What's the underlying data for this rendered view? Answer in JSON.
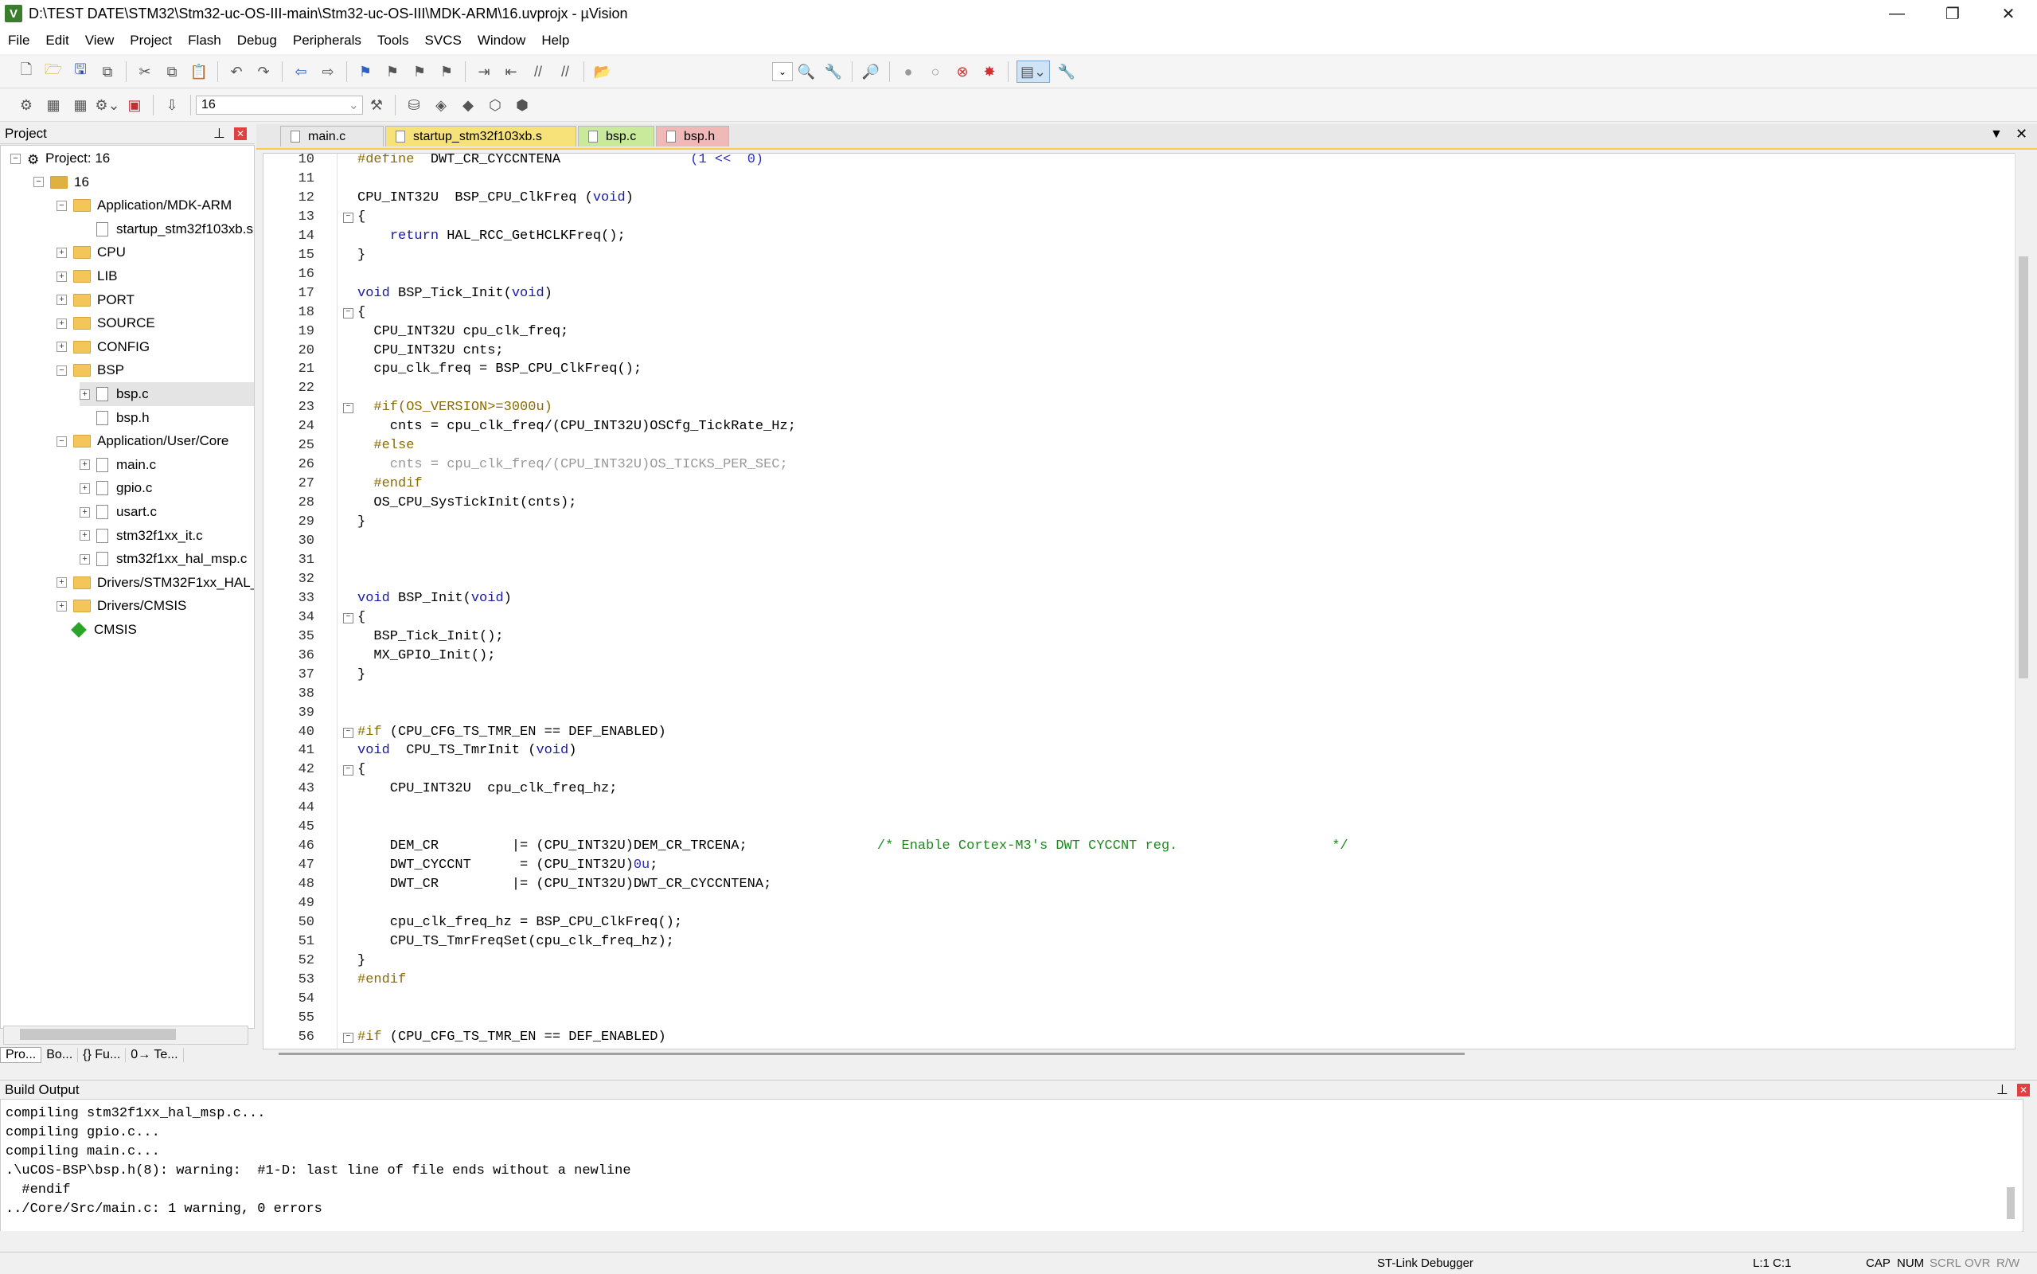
{
  "window": {
    "title": "D:\\TEST DATE\\STM32\\Stm32-uc-OS-III-main\\Stm32-uc-OS-III\\MDK-ARM\\16.uvprojx - µVision"
  },
  "menu": [
    "File",
    "Edit",
    "View",
    "Project",
    "Flash",
    "Debug",
    "Peripherals",
    "Tools",
    "SVCS",
    "Window",
    "Help"
  ],
  "toolbar2": {
    "target": "16"
  },
  "project": {
    "header": "Project",
    "tree": [
      {
        "label": "Project: 16",
        "depth": 0,
        "type": "root",
        "exp": "−"
      },
      {
        "label": "16",
        "depth": 1,
        "type": "target",
        "exp": "−"
      },
      {
        "label": "Application/MDK-ARM",
        "depth": 2,
        "type": "folder",
        "exp": "−"
      },
      {
        "label": "startup_stm32f103xb.s",
        "depth": 3,
        "type": "file",
        "exp": ""
      },
      {
        "label": "CPU",
        "depth": 2,
        "type": "folder",
        "exp": "+"
      },
      {
        "label": "LIB",
        "depth": 2,
        "type": "folder",
        "exp": "+"
      },
      {
        "label": "PORT",
        "depth": 2,
        "type": "folder",
        "exp": "+"
      },
      {
        "label": "SOURCE",
        "depth": 2,
        "type": "folder",
        "exp": "+"
      },
      {
        "label": "CONFIG",
        "depth": 2,
        "type": "folder",
        "exp": "+"
      },
      {
        "label": "BSP",
        "depth": 2,
        "type": "folder",
        "exp": "−"
      },
      {
        "label": "bsp.c",
        "depth": 3,
        "type": "file",
        "exp": "+"
      },
      {
        "label": "bsp.h",
        "depth": 3,
        "type": "file",
        "exp": ""
      },
      {
        "label": "Application/User/Core",
        "depth": 2,
        "type": "folder",
        "exp": "−"
      },
      {
        "label": "main.c",
        "depth": 3,
        "type": "file",
        "exp": "+"
      },
      {
        "label": "gpio.c",
        "depth": 3,
        "type": "file",
        "exp": "+"
      },
      {
        "label": "usart.c",
        "depth": 3,
        "type": "file",
        "exp": "+"
      },
      {
        "label": "stm32f1xx_it.c",
        "depth": 3,
        "type": "file",
        "exp": "+"
      },
      {
        "label": "stm32f1xx_hal_msp.c",
        "depth": 3,
        "type": "file",
        "exp": "+"
      },
      {
        "label": "Drivers/STM32F1xx_HAL_Driver",
        "depth": 2,
        "type": "folder",
        "exp": "+"
      },
      {
        "label": "Drivers/CMSIS",
        "depth": 2,
        "type": "folder",
        "exp": "+"
      },
      {
        "label": "CMSIS",
        "depth": 2,
        "type": "gem",
        "exp": ""
      }
    ],
    "tabs": [
      "Pro...",
      "Bo...",
      "{} Fu...",
      "0→ Te..."
    ]
  },
  "editor": {
    "tabs": [
      {
        "label": "main.c",
        "color": "#e8e8e8"
      },
      {
        "label": "startup_stm32f103xb.s",
        "color": "#f7e27a"
      },
      {
        "label": "bsp.c",
        "color": "#c9ea9a"
      },
      {
        "label": "bsp.h",
        "color": "#f1b8b8"
      }
    ],
    "lines": [
      {
        "n": "10",
        "fold": "",
        "html": "<span style='color:#8b6c00'>#define</span>  DWT_CR_CYCCNTENA                <span style='color:#3030c0'>(1 &lt;&lt;  0)</span>"
      },
      {
        "n": "11",
        "fold": "",
        "html": ""
      },
      {
        "n": "12",
        "fold": "",
        "html": "CPU_INT32U  BSP_CPU_ClkFreq (<span style='color:#1a1aa6'>void</span>)"
      },
      {
        "n": "13",
        "fold": "−",
        "html": "{"
      },
      {
        "n": "14",
        "fold": "",
        "html": "    <span style='color:#1a1aa6'>return</span> HAL_RCC_GetHCLKFreq();"
      },
      {
        "n": "15",
        "fold": "",
        "html": "}"
      },
      {
        "n": "16",
        "fold": "",
        "html": ""
      },
      {
        "n": "17",
        "fold": "",
        "html": "<span style='color:#1a1aa6'>void</span> BSP_Tick_Init(<span style='color:#1a1aa6'>void</span>)"
      },
      {
        "n": "18",
        "fold": "−",
        "html": "{"
      },
      {
        "n": "19",
        "fold": "",
        "html": "  CPU_INT32U cpu_clk_freq;"
      },
      {
        "n": "20",
        "fold": "",
        "html": "  CPU_INT32U cnts;"
      },
      {
        "n": "21",
        "fold": "",
        "html": "  cpu_clk_freq = BSP_CPU_ClkFreq();"
      },
      {
        "n": "22",
        "fold": "",
        "html": ""
      },
      {
        "n": "23",
        "fold": "−",
        "html": "  <span style='color:#8b6c00'>#if(OS_VERSION&gt;=3000u)</span>"
      },
      {
        "n": "24",
        "fold": "",
        "html": "    cnts = cpu_clk_freq/(CPU_INT32U)OSCfg_TickRate_Hz;"
      },
      {
        "n": "25",
        "fold": "",
        "html": "  <span style='color:#8b6c00'>#else</span>"
      },
      {
        "n": "26",
        "fold": "",
        "html": "<span style='color:#999'>    cnts = cpu_clk_freq/(CPU_INT32U)OS_TICKS_PER_SEC;</span>"
      },
      {
        "n": "27",
        "fold": "",
        "html": "  <span style='color:#8b6c00'>#endif</span>"
      },
      {
        "n": "28",
        "fold": "",
        "html": "  OS_CPU_SysTickInit(cnts);"
      },
      {
        "n": "29",
        "fold": "",
        "html": "}"
      },
      {
        "n": "30",
        "fold": "",
        "html": ""
      },
      {
        "n": "31",
        "fold": "",
        "html": ""
      },
      {
        "n": "32",
        "fold": "",
        "html": ""
      },
      {
        "n": "33",
        "fold": "",
        "html": "<span style='color:#1a1aa6'>void</span> BSP_Init(<span style='color:#1a1aa6'>void</span>)"
      },
      {
        "n": "34",
        "fold": "−",
        "html": "{"
      },
      {
        "n": "35",
        "fold": "",
        "html": "  BSP_Tick_Init();"
      },
      {
        "n": "36",
        "fold": "",
        "html": "  MX_GPIO_Init();"
      },
      {
        "n": "37",
        "fold": "",
        "html": "}"
      },
      {
        "n": "38",
        "fold": "",
        "html": ""
      },
      {
        "n": "39",
        "fold": "",
        "html": ""
      },
      {
        "n": "40",
        "fold": "−",
        "html": "<span style='color:#8b6c00'>#if</span> (CPU_CFG_TS_TMR_EN == DEF_ENABLED)"
      },
      {
        "n": "41",
        "fold": "",
        "html": "<span style='color:#1a1aa6'>void</span>  CPU_TS_TmrInit (<span style='color:#1a1aa6'>void</span>)"
      },
      {
        "n": "42",
        "fold": "−",
        "html": "{"
      },
      {
        "n": "43",
        "fold": "",
        "html": "    CPU_INT32U  cpu_clk_freq_hz;"
      },
      {
        "n": "44",
        "fold": "",
        "html": ""
      },
      {
        "n": "45",
        "fold": "",
        "html": ""
      },
      {
        "n": "46",
        "fold": "",
        "html": "    DEM_CR         |= (CPU_INT32U)DEM_CR_TRCENA;                <span style='color:#1d8a1d'>/* Enable Cortex-M3's DWT CYCCNT reg.                   */</span>"
      },
      {
        "n": "47",
        "fold": "",
        "html": "    DWT_CYCCNT      = (CPU_INT32U)<span style='color:#3030c0'>0u</span>;"
      },
      {
        "n": "48",
        "fold": "",
        "html": "    DWT_CR         |= (CPU_INT32U)DWT_CR_CYCCNTENA;"
      },
      {
        "n": "49",
        "fold": "",
        "html": ""
      },
      {
        "n": "50",
        "fold": "",
        "html": "    cpu_clk_freq_hz = BSP_CPU_ClkFreq();"
      },
      {
        "n": "51",
        "fold": "",
        "html": "    CPU_TS_TmrFreqSet(cpu_clk_freq_hz);"
      },
      {
        "n": "52",
        "fold": "",
        "html": "}"
      },
      {
        "n": "53",
        "fold": "",
        "html": "<span style='color:#8b6c00'>#endif</span>"
      },
      {
        "n": "54",
        "fold": "",
        "html": ""
      },
      {
        "n": "55",
        "fold": "",
        "html": ""
      },
      {
        "n": "56",
        "fold": "−",
        "html": "<span style='color:#8b6c00'>#if</span> (CPU_CFG_TS_TMR_EN == DEF_ENABLED)"
      }
    ]
  },
  "build": {
    "header": "Build Output",
    "lines": [
      "compiling stm32f1xx_hal_msp.c...",
      "compiling gpio.c...",
      "compiling main.c...",
      ".\\uCOS-BSP\\bsp.h(8): warning:  #1-D: last line of file ends without a newline",
      "  #endif",
      "../Core/Src/main.c: 1 warning, 0 errors"
    ]
  },
  "status": {
    "debugger": "ST-Link Debugger",
    "position": "L:1 C:1",
    "flags": [
      "CAP",
      "NUM",
      "SCRL",
      "OVR",
      "R/W"
    ]
  }
}
